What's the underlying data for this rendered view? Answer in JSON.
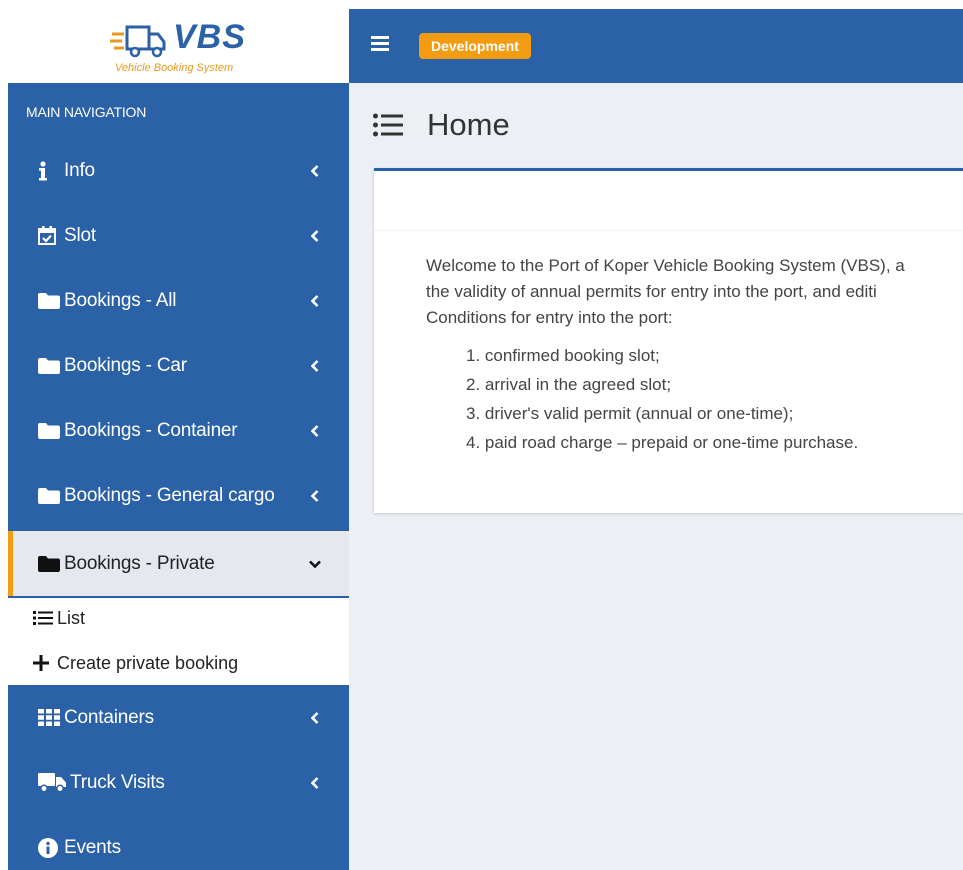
{
  "logo": {
    "title": "VBS",
    "subtitle": "Vehicle Booking System"
  },
  "sidebar": {
    "header": "MAIN NAVIGATION",
    "items": [
      {
        "label": "Info",
        "icon": "info-icon"
      },
      {
        "label": "Slot",
        "icon": "calendar-check-icon"
      },
      {
        "label": "Bookings - All",
        "icon": "folder-icon"
      },
      {
        "label": "Bookings - Car",
        "icon": "folder-icon"
      },
      {
        "label": "Bookings - Container",
        "icon": "folder-icon"
      },
      {
        "label": "Bookings - General cargo",
        "icon": "folder-icon"
      },
      {
        "label": "Bookings - Private",
        "icon": "folder-icon"
      },
      {
        "label": "Containers",
        "icon": "grid-table-icon"
      },
      {
        "label": "Truck Visits",
        "icon": "truck-icon"
      },
      {
        "label": "Events",
        "icon": "info-circle-icon"
      }
    ],
    "submenu": [
      {
        "label": "List",
        "icon": "list-icon"
      },
      {
        "label": "Create private booking",
        "icon": "plus-icon"
      }
    ]
  },
  "topbar": {
    "env_badge": "Development"
  },
  "page": {
    "title": "Home"
  },
  "card": {
    "welcome_line1": "Welcome to the Port of Koper Vehicle Booking System (VBS), a",
    "welcome_line2": "the validity of annual permits for entry into the port, and editi",
    "conditions_title": "Conditions for entry into the port:",
    "conditions": [
      "1. confirmed booking slot;",
      "2. arrival in the agreed slot;",
      "3. driver's valid permit (annual or one-time);",
      "4. paid road charge – prepaid or one-time purchase."
    ]
  },
  "colors": {
    "primary": "#2b61a6",
    "accent": "#f39c12",
    "content_bg": "#ecf0f5"
  }
}
